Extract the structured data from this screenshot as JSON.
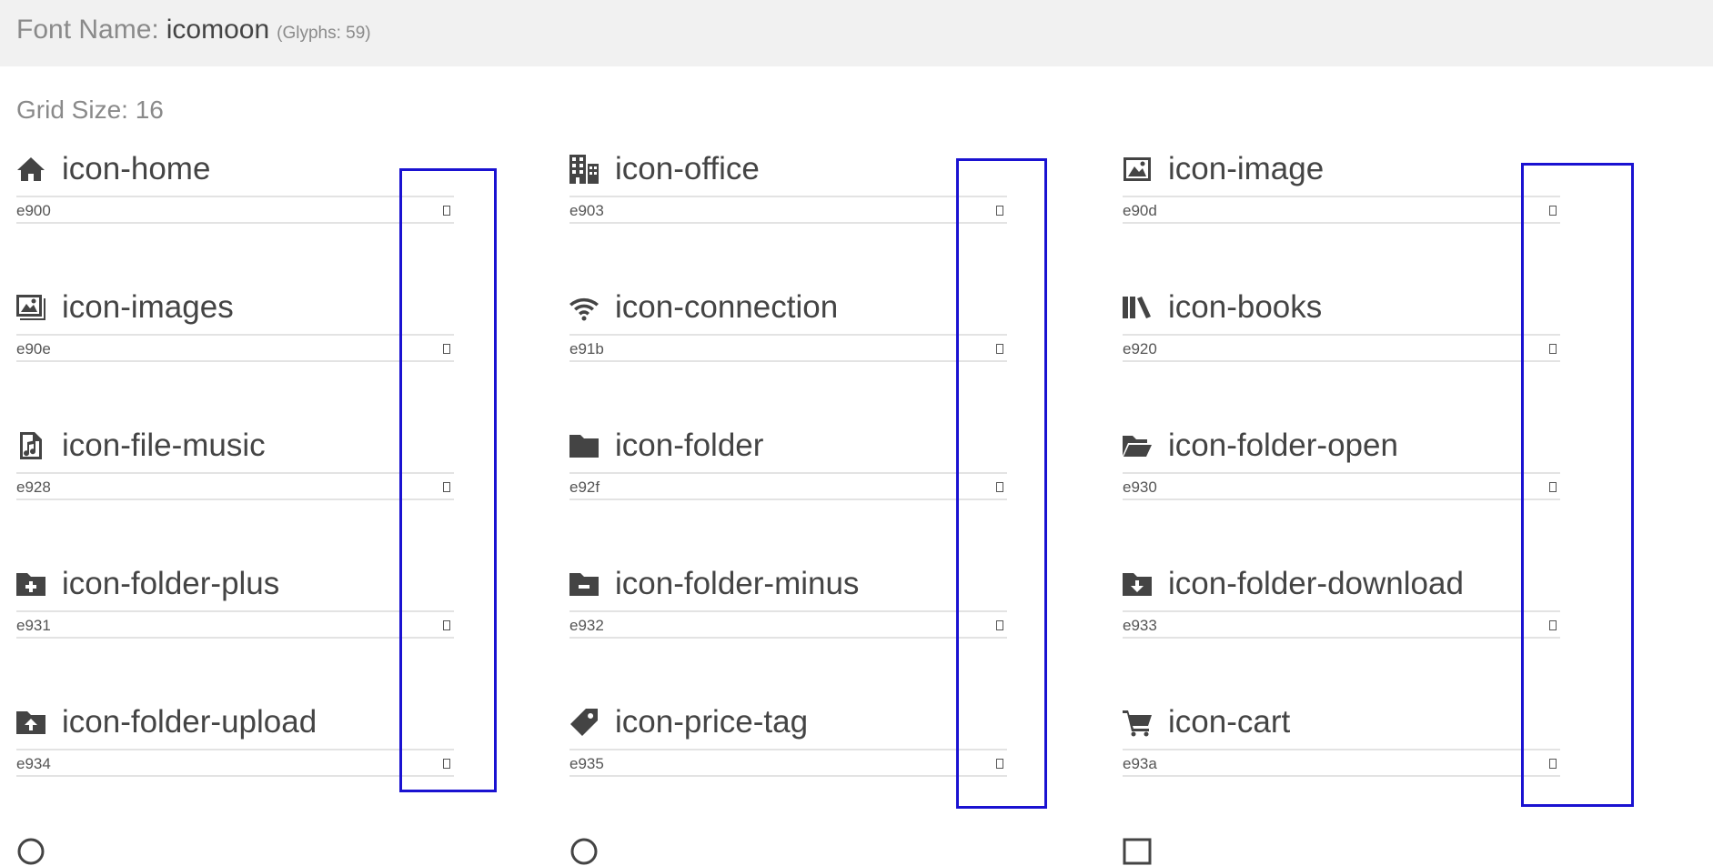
{
  "header": {
    "label": "Font Name:",
    "font_name": "icomoon",
    "glyph_count": "(Glyphs: 59)"
  },
  "grid_size": "Grid Size: 16",
  "columns": [
    {
      "items": [
        {
          "name": "icon-home",
          "code": "e900",
          "icon": "home-icon"
        },
        {
          "name": "icon-images",
          "code": "e90e",
          "icon": "images-icon"
        },
        {
          "name": "icon-file-music",
          "code": "e928",
          "icon": "file-music-icon"
        },
        {
          "name": "icon-folder-plus",
          "code": "e931",
          "icon": "folder-plus-icon"
        },
        {
          "name": "icon-folder-upload",
          "code": "e934",
          "icon": "folder-upload-icon"
        }
      ]
    },
    {
      "items": [
        {
          "name": "icon-office",
          "code": "e903",
          "icon": "office-icon"
        },
        {
          "name": "icon-connection",
          "code": "e91b",
          "icon": "connection-icon"
        },
        {
          "name": "icon-folder",
          "code": "e92f",
          "icon": "folder-icon"
        },
        {
          "name": "icon-folder-minus",
          "code": "e932",
          "icon": "folder-minus-icon"
        },
        {
          "name": "icon-price-tag",
          "code": "e935",
          "icon": "price-tag-icon"
        }
      ]
    },
    {
      "items": [
        {
          "name": "icon-image",
          "code": "e90d",
          "icon": "image-icon"
        },
        {
          "name": "icon-books",
          "code": "e920",
          "icon": "books-icon"
        },
        {
          "name": "icon-folder-open",
          "code": "e930",
          "icon": "folder-open-icon"
        },
        {
          "name": "icon-folder-download",
          "code": "e933",
          "icon": "folder-download-icon"
        },
        {
          "name": "icon-cart",
          "code": "e93a",
          "icon": "cart-icon"
        }
      ]
    }
  ],
  "highlight_color": "#1a12d1"
}
